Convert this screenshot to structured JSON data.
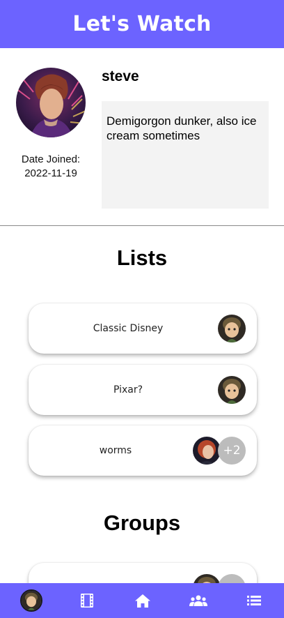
{
  "header": {
    "title": "Let's Watch"
  },
  "profile": {
    "username": "steve",
    "date_joined_label": "Date Joined:",
    "date_joined": "2022-11-19",
    "bio": "Demigorgon dunker, also ice cream sometimes"
  },
  "lists": {
    "title": "Lists",
    "items": [
      {
        "name": "Classic Disney",
        "members": [
          "cartoon-avatar"
        ]
      },
      {
        "name": "Pixar?",
        "members": [
          "cartoon-avatar"
        ]
      },
      {
        "name": "worms",
        "members": [
          "redhead-avatar"
        ],
        "extra": "+2"
      }
    ]
  },
  "groups": {
    "title": "Groups",
    "items": [
      {
        "name": "",
        "members": [
          "cartoon-avatar"
        ],
        "extra": ""
      }
    ]
  },
  "bottom_nav": {
    "items": [
      "profile-avatar",
      "film-icon",
      "home-icon",
      "people-icon",
      "list-icon"
    ]
  },
  "colors": {
    "accent": "#6c63ff",
    "bio_bg": "#f3f3f3",
    "badge": "#bcbcbc"
  }
}
